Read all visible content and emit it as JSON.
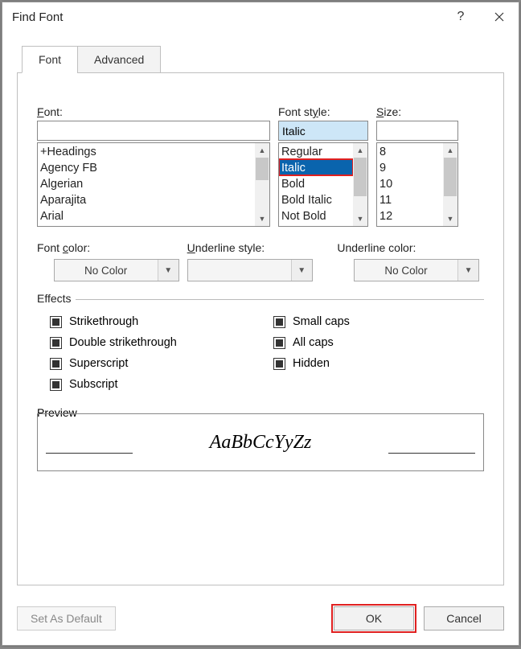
{
  "title": "Find Font",
  "tabs": {
    "font": "Font",
    "advanced": "Advanced"
  },
  "font_section": {
    "label_html": "<span class='ul'>F</span>ont:",
    "value": "",
    "list": [
      "+Headings",
      "Agency FB",
      "Algerian",
      "Aparajita",
      "Arial"
    ]
  },
  "style_section": {
    "label_html": "Font st<span class='ul'>y</span>le:",
    "value": "Italic",
    "list": [
      "Regular",
      "Italic",
      "Bold",
      "Bold Italic",
      "Not Bold"
    ],
    "selected_index": 1
  },
  "size_section": {
    "label_html": "<span class='ul'>S</span>ize:",
    "value": "",
    "list": [
      "8",
      "9",
      "10",
      "11",
      "12"
    ]
  },
  "font_color": {
    "label_html": "Font <span class='ul'>c</span>olor:",
    "value": "No Color"
  },
  "underline_style": {
    "label_html": "<span class='ul'>U</span>nderline style:",
    "value": ""
  },
  "underline_color": {
    "label_html": "Underline color:",
    "value": "No Color"
  },
  "effects": {
    "legend": "Effects",
    "left": [
      {
        "label_html": "Stri<span class='ul'>k</span>ethrough"
      },
      {
        "label_html": "Doub<span class='ul'>l</span>e strikethrough"
      },
      {
        "label_html": "Su<span class='ul'>p</span>erscript"
      },
      {
        "label_html": "Su<span class='ul'>b</span>script"
      }
    ],
    "right": [
      {
        "label_html": "S<span class='ul'>m</span>all caps"
      },
      {
        "label_html": "<span class='ul'>A</span>ll caps"
      },
      {
        "label_html": "<span class='ul'>H</span>idden"
      }
    ]
  },
  "preview": {
    "legend": "Preview",
    "sample": "AaBbCcYyZz"
  },
  "footer": {
    "default": "Set As Default",
    "ok": "OK",
    "cancel": "Cancel"
  }
}
